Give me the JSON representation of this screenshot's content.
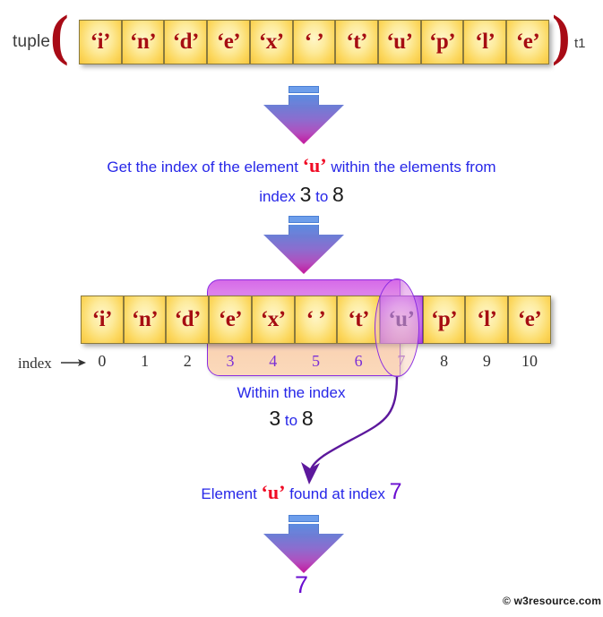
{
  "top_row": {
    "label": "tuple",
    "open_paren": "(",
    "close_paren": ")",
    "var_name": "t1",
    "elements": [
      "‘i’",
      "‘n’",
      "‘d’",
      "‘e’",
      "‘x’",
      "‘ ’",
      "‘t’",
      "‘u’",
      "‘p’",
      "‘l’",
      "‘e’"
    ]
  },
  "step1": {
    "line1_a": "Get the index of the element ",
    "line1_target": "‘u’",
    "line1_b": " within the elements from",
    "line2_a": "index ",
    "line2_start": "3",
    "line2_mid": " to ",
    "line2_end": "8"
  },
  "second_row": {
    "elements": [
      "‘i’",
      "‘n’",
      "‘d’",
      "‘e’",
      "‘x’",
      "‘ ’",
      "‘t’",
      "‘u’",
      "‘p’",
      "‘l’",
      "‘e’"
    ],
    "selected_index": 7,
    "range_start": 3,
    "range_end": 7,
    "index_label": "index",
    "indices": [
      "0",
      "1",
      "2",
      "3",
      "4",
      "5",
      "6",
      "7",
      "8",
      "9",
      "10"
    ]
  },
  "range_caption": {
    "line1": "Within the index",
    "start": "3",
    "mid": " to ",
    "end": "8"
  },
  "found_caption": {
    "a": "Element ",
    "target": "‘u’",
    "b": " found at index ",
    "index": "7"
  },
  "result": {
    "value": "7"
  },
  "watermark": {
    "text": "© w3resource.com"
  },
  "colors": {
    "cell_fill": "#fcd860",
    "cell_text": "#a60d12",
    "selected_fill": "#c36ae8",
    "caption_blue": "#2727e8",
    "accent_purple": "#6a0dd0",
    "accent_red": "#f00b24",
    "paren_red": "#a80b16",
    "range_border": "#8a2be2"
  },
  "icons": {
    "down_arrow": "down-arrow-icon",
    "index_arrow": "right-arrow-icon",
    "curve_arrow": "curved-arrow-icon"
  }
}
